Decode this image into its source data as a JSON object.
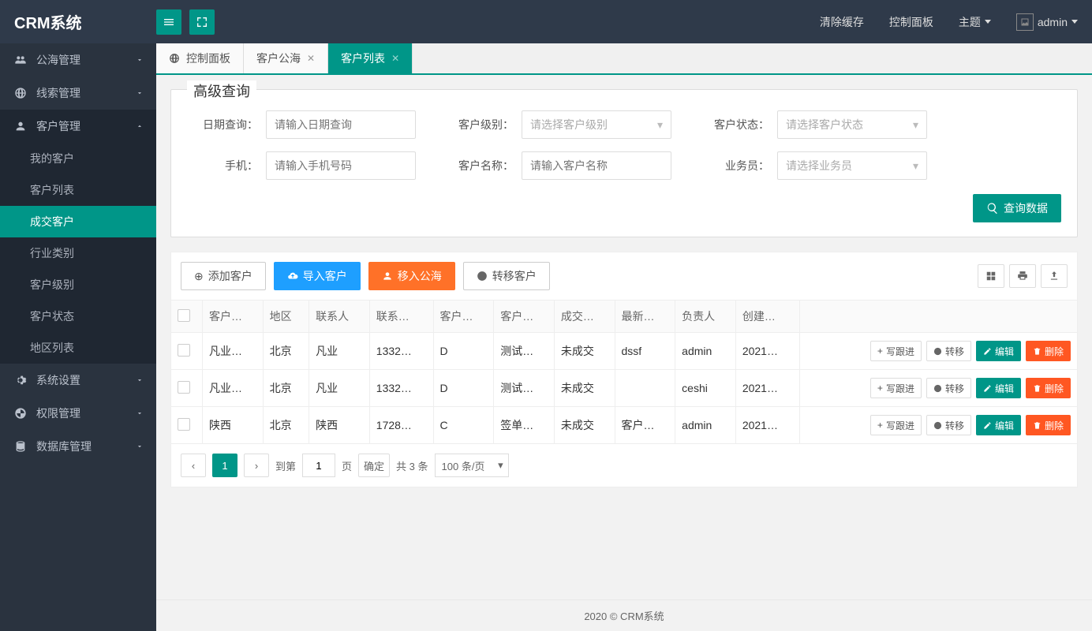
{
  "brand": "CRM系统",
  "top": {
    "clear_cache": "清除缓存",
    "control_panel": "控制面板",
    "theme": "主题",
    "user": "admin"
  },
  "sidebar": [
    {
      "icon": "group",
      "label": "公海管理",
      "expanded": false
    },
    {
      "icon": "globe",
      "label": "线索管理",
      "expanded": false
    },
    {
      "icon": "user",
      "label": "客户管理",
      "expanded": true,
      "children": [
        {
          "label": "我的客户"
        },
        {
          "label": "客户列表"
        },
        {
          "label": "成交客户",
          "active": true
        },
        {
          "label": "行业类别"
        },
        {
          "label": "客户级别"
        },
        {
          "label": "客户状态"
        },
        {
          "label": "地区列表"
        }
      ]
    },
    {
      "icon": "gear",
      "label": "系统设置",
      "expanded": false
    },
    {
      "icon": "shield",
      "label": "权限管理",
      "expanded": false
    },
    {
      "icon": "db",
      "label": "数据库管理",
      "expanded": false
    }
  ],
  "tabs": [
    {
      "label": "控制面板",
      "home": true,
      "closable": false
    },
    {
      "label": "客户公海",
      "closable": true
    },
    {
      "label": "客户列表",
      "closable": true,
      "active": true
    }
  ],
  "query": {
    "legend": "高级查询",
    "fields": {
      "date": {
        "label": "日期查询：",
        "placeholder": "请输入日期查询"
      },
      "level": {
        "label": "客户级别：",
        "placeholder": "请选择客户级别"
      },
      "status": {
        "label": "客户状态：",
        "placeholder": "请选择客户状态"
      },
      "phone": {
        "label": "手机：",
        "placeholder": "请输入手机号码"
      },
      "name": {
        "label": "客户名称：",
        "placeholder": "请输入客户名称"
      },
      "staff": {
        "label": "业务员：",
        "placeholder": "请选择业务员"
      }
    },
    "search_btn": "查询数据"
  },
  "toolbar": {
    "add": "添加客户",
    "import": "导入客户",
    "to_public": "移入公海",
    "transfer": "转移客户"
  },
  "table": {
    "headers": [
      "客户…",
      "地区",
      "联系人",
      "联系…",
      "客户…",
      "客户…",
      "成交…",
      "最新…",
      "负责人",
      "创建…"
    ],
    "rows": [
      {
        "cells": [
          "凡业…",
          "北京",
          "凡业",
          "1332…",
          "D",
          "测试…",
          "未成交",
          "dssf",
          "admin",
          "2021…"
        ]
      },
      {
        "cells": [
          "凡业…",
          "北京",
          "凡业",
          "1332…",
          "D",
          "测试…",
          "未成交",
          "",
          "ceshi",
          "2021…"
        ]
      },
      {
        "cells": [
          "陕西",
          "北京",
          "陕西",
          "1728…",
          "C",
          "签单…",
          "未成交",
          "客户…",
          "admin",
          "2021…"
        ]
      }
    ],
    "actions": {
      "follow": "写跟进",
      "transfer": "转移",
      "edit": "编辑",
      "delete": "删除"
    }
  },
  "pager": {
    "current": "1",
    "goto_prefix": "到第",
    "goto_suffix": "页",
    "goto_value": "1",
    "confirm": "确定",
    "total": "共 3 条",
    "size": "100 条/页"
  },
  "footer": "2020 ©    CRM系统"
}
